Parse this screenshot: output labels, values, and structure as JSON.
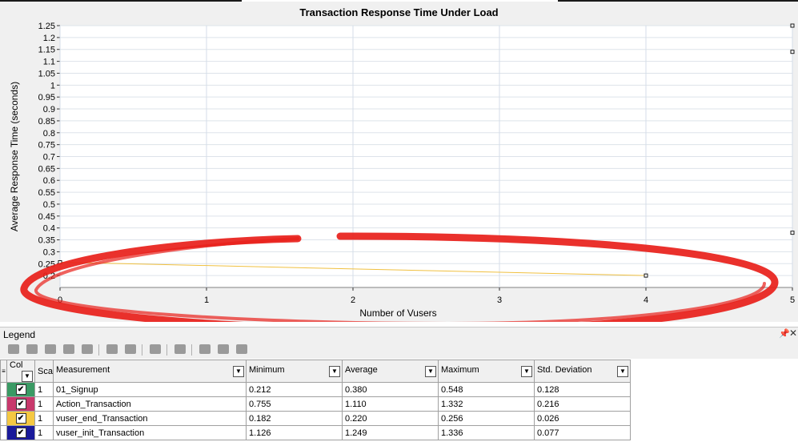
{
  "chart_data": {
    "type": "line",
    "title": "Transaction Response Time Under Load",
    "xlabel": "Number of Vusers",
    "ylabel": "Average Response Time (seconds)",
    "xlim": [
      0,
      5
    ],
    "ylim": [
      0.15,
      1.25
    ],
    "xticks": [
      "0",
      "1",
      "2",
      "3",
      "4",
      "5"
    ],
    "yticks": [
      "0.2",
      "0.25",
      "0.3",
      "0.35",
      "0.4",
      "0.45",
      "0.5",
      "0.55",
      "0.6",
      "0.65",
      "0.7",
      "0.75",
      "0.8",
      "0.85",
      "0.9",
      "0.95",
      "1",
      "1.05",
      "1.1",
      "1.15",
      "1.2",
      "1.25"
    ],
    "grid": true,
    "series": [
      {
        "name": "vuser_end_Transaction",
        "color": "#f0c040",
        "points": [
          [
            0,
            0.256
          ],
          [
            4,
            0.2
          ]
        ]
      },
      {
        "name": "01_Signup",
        "color": "#2e8b57",
        "points": [
          [
            5,
            0.38
          ]
        ]
      },
      {
        "name": "Action_Transaction",
        "color": "#c8396c",
        "points": [
          [
            5,
            1.14
          ]
        ]
      },
      {
        "name": "vuser_init_Transaction",
        "color": "#1a1a9a",
        "points": [
          [
            5,
            1.25
          ]
        ]
      }
    ]
  },
  "legend": {
    "title": "Legend",
    "columns": [
      "Col",
      "Sca",
      "Measurement",
      "Minimum",
      "Average",
      "Maximum",
      "Std. Deviation"
    ],
    "rows": [
      {
        "color": "#3a9a64",
        "scale": "1",
        "measurement": "01_Signup",
        "min": "0.212",
        "avg": "0.380",
        "max": "0.548",
        "std": "0.128"
      },
      {
        "color": "#c8396c",
        "scale": "1",
        "measurement": "Action_Transaction",
        "min": "0.755",
        "avg": "1.110",
        "max": "1.332",
        "std": "0.216"
      },
      {
        "color": "#f5c842",
        "scale": "1",
        "measurement": "vuser_end_Transaction",
        "min": "0.182",
        "avg": "0.220",
        "max": "0.256",
        "std": "0.026"
      },
      {
        "color": "#1a1a9a",
        "scale": "1",
        "measurement": "vuser_init_Transaction",
        "min": "1.126",
        "avg": "1.249",
        "max": "1.336",
        "std": "0.077"
      }
    ]
  },
  "annotation_color": "#e8201a"
}
